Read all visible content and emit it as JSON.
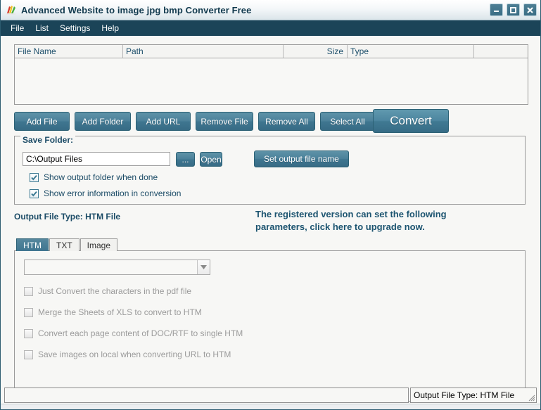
{
  "window": {
    "title": "Advanced Website to image jpg bmp Converter Free",
    "icon": "app-palette-icon",
    "controls": [
      {
        "name": "minimize-button",
        "glyph": "minimize"
      },
      {
        "name": "maximize-button",
        "glyph": "maximize"
      },
      {
        "name": "close-button",
        "glyph": "close"
      }
    ]
  },
  "menubar": {
    "items": [
      {
        "label": "File"
      },
      {
        "label": "List"
      },
      {
        "label": "Settings"
      },
      {
        "label": "Help"
      }
    ]
  },
  "file_list": {
    "columns": [
      "File Name",
      "Path",
      "Size",
      "Type",
      ""
    ],
    "rows": []
  },
  "toolbar": {
    "buttons": [
      {
        "label": "Add File"
      },
      {
        "label": "Add Folder"
      },
      {
        "label": "Add URL"
      },
      {
        "label": "Remove File"
      },
      {
        "label": "Remove All"
      },
      {
        "label": "Select All"
      }
    ],
    "convert_label": "Convert"
  },
  "save_folder": {
    "title": "Save Folder:",
    "path_value": "C:\\Output Files",
    "path_placeholder": "",
    "browse_label": "...",
    "open_label": "Open",
    "set_output_label": "Set output file name",
    "checkboxes": [
      {
        "label": "Show output folder when done",
        "checked": true
      },
      {
        "label": "Show error information in conversion",
        "checked": true
      }
    ]
  },
  "output_type_line": "Output File Type:  HTM File",
  "upgrade_message": "The registered version can set the following parameters, click here to upgrade now.",
  "tabs": {
    "items": [
      {
        "label": "HTM",
        "active": true
      },
      {
        "label": "TXT",
        "active": false
      },
      {
        "label": "Image",
        "active": false
      }
    ]
  },
  "options_panel": {
    "combo_value": "",
    "options": [
      {
        "label": "Just Convert the characters in the pdf file",
        "checked": false,
        "disabled": true
      },
      {
        "label": "Merge the Sheets of XLS to convert to HTM",
        "checked": false,
        "disabled": true
      },
      {
        "label": "Convert each page content of DOC/RTF to single HTM",
        "checked": false,
        "disabled": true
      },
      {
        "label": "Save images on local when converting URL to HTM",
        "checked": false,
        "disabled": true
      }
    ]
  },
  "statusbar": {
    "left_text": "",
    "right_text": "Output File Type:  HTM File"
  },
  "colors": {
    "menubar_bg": "#1b4458",
    "accent_teal": "#2c6175",
    "button_gradient_top": "#5f93a8",
    "button_gradient_bottom": "#376b85",
    "header_text": "#1d4f6b",
    "upgrade_text": "#1c5470",
    "disabled_text": "#9b9b9b",
    "window_bg": "#f7f7f5"
  }
}
